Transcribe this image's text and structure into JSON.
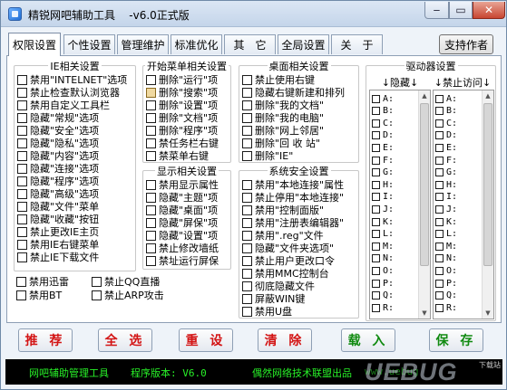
{
  "window": {
    "title": "精锐网吧辅助工具    -v6.0正式版"
  },
  "titlebar": {
    "minimize": "‒",
    "maximize": "▭",
    "close": "✕"
  },
  "tabs": [
    "权限设置",
    "个性设置",
    "管理维护",
    "标准优化",
    "其　它",
    "全局设置",
    "关　于"
  ],
  "support_button": "支持作者",
  "ie_group": {
    "title": "IE相关设置",
    "items": [
      {
        "label": "禁用\"INTELNET\"选项",
        "checked": false
      },
      {
        "label": "禁止检查默认浏览器",
        "checked": false
      },
      {
        "label": "禁用自定义工具栏",
        "checked": false
      },
      {
        "label": "隐藏\"常规\"选项",
        "checked": false
      },
      {
        "label": "隐藏\"安全\"选项",
        "checked": false
      },
      {
        "label": "隐藏\"隐私\"选项",
        "checked": false
      },
      {
        "label": "隐藏\"内容\"选项",
        "checked": false
      },
      {
        "label": "隐藏\"连接\"选项",
        "checked": false
      },
      {
        "label": "隐藏\"程序\"选项",
        "checked": false
      },
      {
        "label": "隐藏\"高级\"选项",
        "checked": false
      },
      {
        "label": "隐藏\"文件\"菜单",
        "checked": false
      },
      {
        "label": "隐藏\"收藏\"按钮",
        "checked": false
      },
      {
        "label": "禁止更改IE主页",
        "checked": false
      },
      {
        "label": "禁用IE右键菜单",
        "checked": false
      },
      {
        "label": "禁止IE下载文件",
        "checked": false
      }
    ]
  },
  "extra": [
    {
      "label": "禁用迅雷",
      "checked": false
    },
    {
      "label": "禁止QQ直播",
      "checked": false
    },
    {
      "label": "禁用BT",
      "checked": false
    },
    {
      "label": "禁止ARP攻击",
      "checked": false
    }
  ],
  "start_group": {
    "title": "开始菜单相关设置",
    "items": [
      {
        "label": "删除\"运行\"项",
        "checked": false
      },
      {
        "label": "删除\"搜索\"项",
        "checked": true
      },
      {
        "label": "删除\"设置\"项",
        "checked": false
      },
      {
        "label": "删除\"文档\"项",
        "checked": false
      },
      {
        "label": "删除\"程序\"项",
        "checked": false
      },
      {
        "label": "禁任务栏右键",
        "checked": false
      },
      {
        "label": "禁菜单右键",
        "checked": false
      }
    ]
  },
  "display_group": {
    "title": "显示相关设置",
    "items": [
      {
        "label": "禁用显示属性",
        "checked": false
      },
      {
        "label": "隐藏\"主题\"项",
        "checked": false
      },
      {
        "label": "隐藏\"桌面\"项",
        "checked": false
      },
      {
        "label": "隐藏\"屏保\"项",
        "checked": false
      },
      {
        "label": "隐藏\"设置\"项",
        "checked": false
      },
      {
        "label": "禁止修改墙纸",
        "checked": false
      },
      {
        "label": "禁址运行屏保",
        "checked": false
      }
    ]
  },
  "desktop_group": {
    "title": "桌面相关设置",
    "items": [
      {
        "label": "禁止使用右键",
        "checked": false
      },
      {
        "label": "隐藏右键新建和排列",
        "checked": false
      },
      {
        "label": "删除\"我的文档\"",
        "checked": false
      },
      {
        "label": "删除\"我的电脑\"",
        "checked": false
      },
      {
        "label": "删除\"网上邻居\"",
        "checked": false
      },
      {
        "label": "删除\"回 收 站\"",
        "checked": false
      },
      {
        "label": "删除\"IE\"",
        "checked": false
      }
    ]
  },
  "security_group": {
    "title": "系统安全设置",
    "items": [
      {
        "label": "禁用\"本地连接\"属性",
        "checked": false
      },
      {
        "label": "禁止停用\"本地连接\"",
        "checked": false
      },
      {
        "label": "禁用\"控制面版\"",
        "checked": false
      },
      {
        "label": "禁用\"注册表编辑器\"",
        "checked": false
      },
      {
        "label": "禁用\".reg\"文件",
        "checked": false
      },
      {
        "label": "隐藏\"文件夹选项\"",
        "checked": false
      },
      {
        "label": "禁止用户更改口令",
        "checked": false
      },
      {
        "label": "禁用MMC控制台",
        "checked": false
      },
      {
        "label": "彻底隐藏文件",
        "checked": false
      },
      {
        "label": "屏蔽WIN键",
        "checked": false
      },
      {
        "label": "禁用U盘",
        "checked": false
      }
    ]
  },
  "drive_group": {
    "title": "驱动器设置",
    "hide_header": "↓隐藏↓",
    "deny_header": "↓禁止访问↓",
    "letters": [
      "A:",
      "B:",
      "C:",
      "D:",
      "E:",
      "F:",
      "G:",
      "H:",
      "I:",
      "J:",
      "K:",
      "L:",
      "M:",
      "N:",
      "O:",
      "P:",
      "Q:",
      "R:"
    ]
  },
  "actions": {
    "recommend": "推 荐",
    "select_all": "全 选",
    "reset": "重 设",
    "clear": "清 除",
    "load": "载 入",
    "save": "保 存"
  },
  "status": {
    "left": "网吧辅助管理工具",
    "version": "程序版本: V6.0",
    "right": "偶然网络技术联盟出品",
    "url": "www.uebug"
  },
  "watermark": {
    "text": "UEBUG",
    "sub": "下载站"
  },
  "colors": {
    "status_bg": "#000000",
    "status_text": "#28f028",
    "action_red": "#d31414",
    "action_green": "#108a10"
  }
}
